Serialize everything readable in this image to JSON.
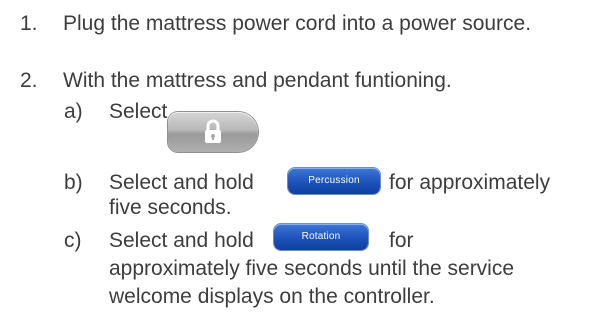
{
  "steps": [
    {
      "num": "1.",
      "text": "Plug the mattress power cord into a power source."
    },
    {
      "num": "2.",
      "text": "With the mattress and pendant funtioning."
    }
  ],
  "substeps": {
    "a": {
      "label": "a)",
      "text": "Select"
    },
    "b": {
      "label": "b)",
      "before": "Select  and hold",
      "after": "for approximately",
      "cont": "five seconds."
    },
    "c": {
      "label": "c)",
      "before": "Select and hold",
      "after": "for",
      "cont1": "approximately five seconds until the service",
      "cont2": "welcome displays on the controller."
    }
  },
  "buttons": {
    "lock_icon": "lock-icon",
    "percussion": "Percussion",
    "rotation": "Rotation"
  },
  "colors": {
    "text": "#3d3d3d",
    "button_blue": "#1f55bd",
    "button_gray": "#b0b0b0"
  }
}
